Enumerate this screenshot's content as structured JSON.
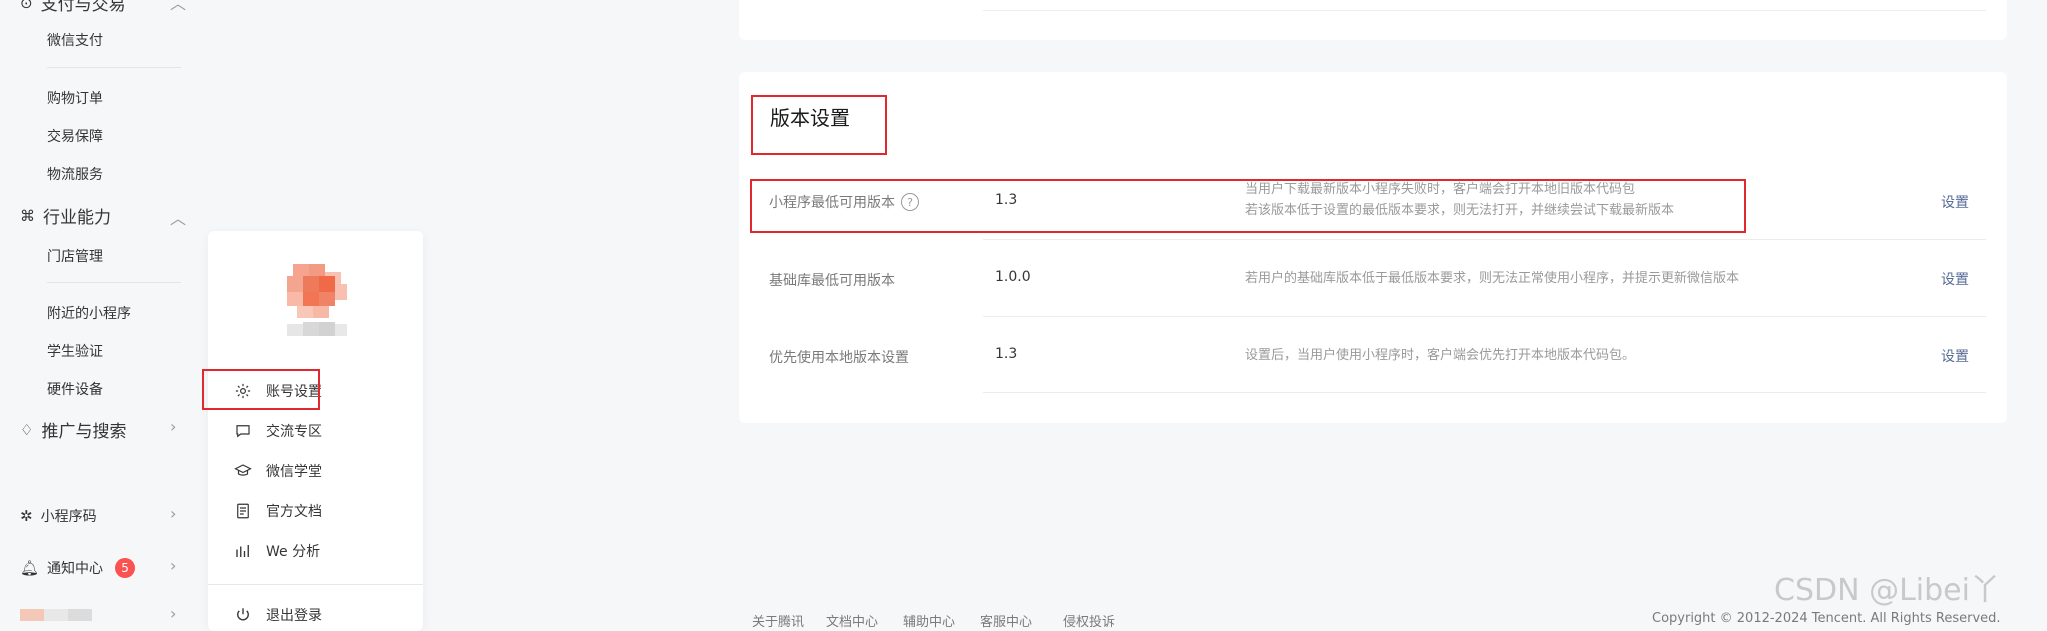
{
  "sidebar": {
    "cut_group": "支付与交易",
    "payment_items": [
      "微信支付"
    ],
    "trade_items": [
      "购物订单",
      "交易保障",
      "物流服务"
    ],
    "industry_group": "行业能力",
    "store_items": [
      "门店管理"
    ],
    "other_items": [
      "附近的小程序",
      "学生验证",
      "硬件设备"
    ],
    "promo_group": "推广与搜索",
    "qrcode": "小程序码",
    "notify": "通知中心",
    "notify_badge": "5"
  },
  "popup": {
    "items": [
      "账号设置",
      "交流专区",
      "微信学堂",
      "官方文档",
      "We 分析"
    ],
    "logout": "退出登录"
  },
  "version_card": {
    "title": "版本设置",
    "action_label": "设置",
    "rows": [
      {
        "label": "小程序最低可用版本",
        "value": "1.3",
        "desc_line1": "当用户下载最新版本小程序失败时，客户端会打开本地旧版本代码包",
        "desc_line2": "若该版本低于设置的最低版本要求，则无法打开，并继续尝试下载最新版本"
      },
      {
        "label": "基础库最低可用版本",
        "value": "1.0.0",
        "desc_line1": "若用户的基础库版本低于最低版本要求，则无法正常使用小程序，并提示更新微信版本"
      },
      {
        "label": "优先使用本地版本设置",
        "value": "1.3",
        "desc_line1": "设置后，当用户使用小程序时，客户端会优先打开本地版本代码包。"
      }
    ]
  },
  "footer": {
    "links": [
      "关于腾讯",
      "文档中心",
      "辅助中心",
      "客服中心",
      "侵权投诉"
    ],
    "copyright": "Copyright © 2012-2024 Tencent. All Rights Reserved."
  },
  "watermark": "CSDN @Libei丫",
  "colors": {
    "link": "#576b95",
    "highlight": "#e0282e",
    "badge": "#fa5151"
  }
}
